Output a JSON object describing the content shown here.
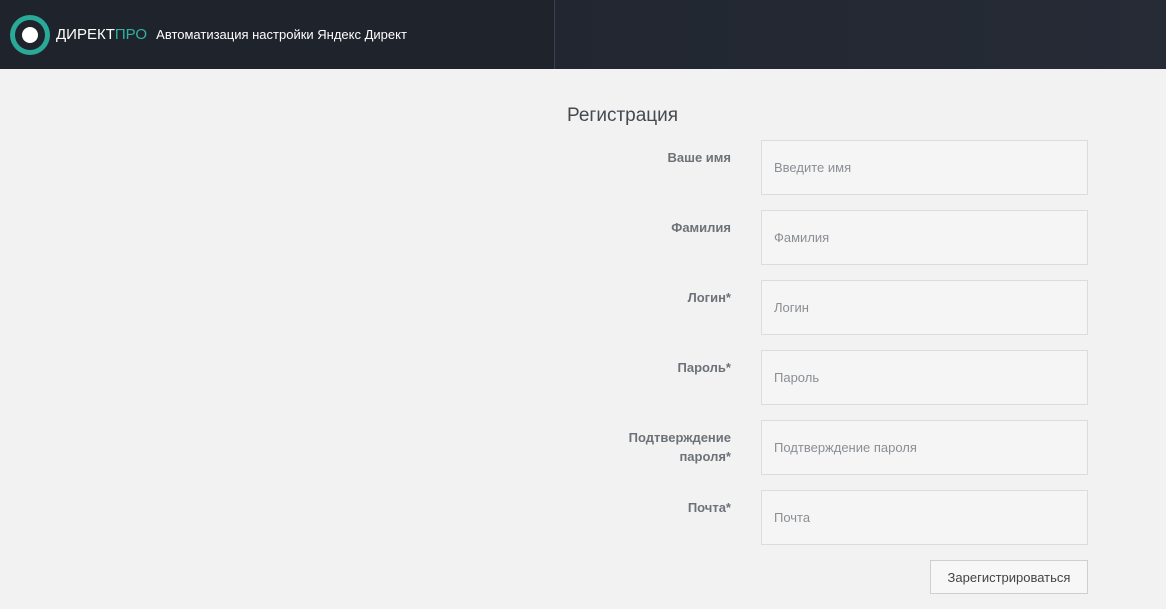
{
  "header": {
    "brand_part1": "ДИРЕКТ",
    "brand_part2": "ПРО",
    "tagline": "Автоматизация настройки Яндекс Директ",
    "logo_icon": "target-ring-icon",
    "accent_color": "#2aa898"
  },
  "form": {
    "title": "Регистрация",
    "fields": [
      {
        "label": "Ваше имя",
        "placeholder": "Введите имя",
        "value": ""
      },
      {
        "label": "Фамилия",
        "placeholder": "Фамилия",
        "value": ""
      },
      {
        "label": "Логин*",
        "placeholder": "Логин",
        "value": ""
      },
      {
        "label": "Пароль*",
        "placeholder": "Пароль",
        "value": ""
      },
      {
        "label_line1": "Подтверждение",
        "label_line2": "пароля*",
        "placeholder": "Подтверждение пароля",
        "value": ""
      },
      {
        "label": "Почта*",
        "placeholder": "Почта",
        "value": ""
      }
    ],
    "submit_label": "Зарегистрироваться"
  }
}
